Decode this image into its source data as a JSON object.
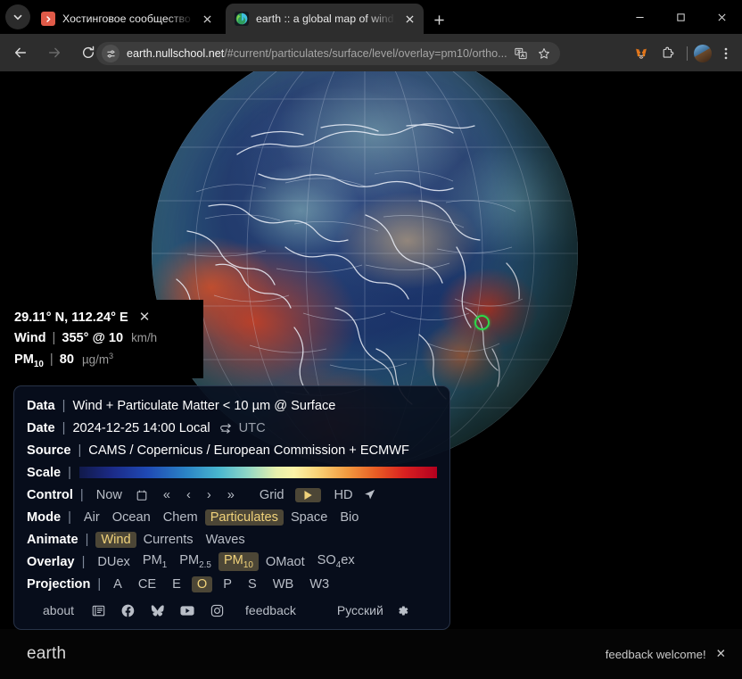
{
  "browser": {
    "tabs": [
      {
        "title": "Хостинговое сообщество «Tim",
        "favicon": "timeweb-icon",
        "active": false
      },
      {
        "title": "earth :: a global map of wind, w",
        "favicon": "earth-icon",
        "active": true
      }
    ],
    "new_tab_label": "+",
    "window_controls": {
      "minimize": "minimize-icon",
      "maximize": "maximize-icon",
      "close": "close-icon"
    },
    "nav": {
      "back": "back-arrow-icon",
      "forward": "forward-arrow-icon",
      "reload": "reload-icon"
    },
    "omnibox": {
      "site_settings_icon": "tune-icon",
      "domain": "earth.nullschool.net",
      "path": "/#current/particulates/surface/level/overlay=pm10/ortho...",
      "translate_icon": "translate-icon",
      "bookmark_icon": "star-icon"
    },
    "toolbar_icons": [
      "metamask-fox-icon",
      "extensions-icon",
      "profile-avatar",
      "chrome-menu-icon"
    ]
  },
  "readout": {
    "coordinates": "29.11° N, 112.24° E",
    "close_label": "✕",
    "wind": {
      "label": "Wind",
      "value": "355° @ 10",
      "unit": "km/h"
    },
    "particulate": {
      "label": "PM",
      "sub": "10",
      "value": "80",
      "unit_pre": "µg/m",
      "unit_sup": "3"
    }
  },
  "panel": {
    "data": {
      "label": "Data",
      "value": "Wind + Particulate Matter < 10 µm @ Surface"
    },
    "date": {
      "label": "Date",
      "value": "2024-12-25 14:00 Local",
      "toggle_icon": "swap-arrows-icon",
      "alt": "UTC"
    },
    "source": {
      "label": "Source",
      "value": "CAMS / Copernicus / European Commission + ECMWF"
    },
    "scale": {
      "label": "Scale",
      "gradient": [
        "#111a4a",
        "#1f49b4",
        "#2b84c6",
        "#49b6cf",
        "#fbf3a8",
        "#f2993f",
        "#e85c24",
        "#b3001f"
      ]
    },
    "control": {
      "label": "Control",
      "now": "Now",
      "calendar_icon": "calendar-icon",
      "prev_fast": "«",
      "prev": "‹",
      "next": "›",
      "next_fast": "»",
      "grid": "Grid",
      "play_icon": "play-icon",
      "hd": "HD",
      "locate_icon": "navigate-arrow-icon"
    },
    "mode": {
      "label": "Mode",
      "options": [
        "Air",
        "Ocean",
        "Chem",
        "Particulates",
        "Space",
        "Bio"
      ],
      "selected": "Particulates"
    },
    "animate": {
      "label": "Animate",
      "options": [
        "Wind",
        "Currents",
        "Waves"
      ],
      "selected": "Wind"
    },
    "overlay": {
      "label": "Overlay",
      "options": [
        {
          "text": "DUex"
        },
        {
          "text": "PM",
          "sub": "1"
        },
        {
          "text": "PM",
          "sub": "2.5"
        },
        {
          "text": "PM",
          "sub": "10"
        },
        {
          "text": "OMaot"
        },
        {
          "text": "SO",
          "sub": "4",
          "post": "ex"
        }
      ],
      "selected": "PM10"
    },
    "projection": {
      "label": "Projection",
      "options": [
        "A",
        "CE",
        "E",
        "O",
        "P",
        "S",
        "WB",
        "W3"
      ],
      "selected": "O"
    },
    "footer": {
      "about": "about",
      "icons": [
        "news-icon",
        "facebook-icon",
        "bluesky-icon",
        "youtube-icon",
        "instagram-icon"
      ],
      "feedback": "feedback",
      "language": "Русский",
      "settings_icon": "gear-icon"
    }
  },
  "page_bar": {
    "brand": "earth",
    "feedback_text": "feedback welcome!",
    "close_label": "✕"
  },
  "colors": {
    "accent_selected_bg": "#4c4636",
    "accent_selected_text": "#f0d27a",
    "marker": "#2bd94a",
    "panel_bg": "#080e1e",
    "chrome_bg": "#2d2d2d"
  }
}
